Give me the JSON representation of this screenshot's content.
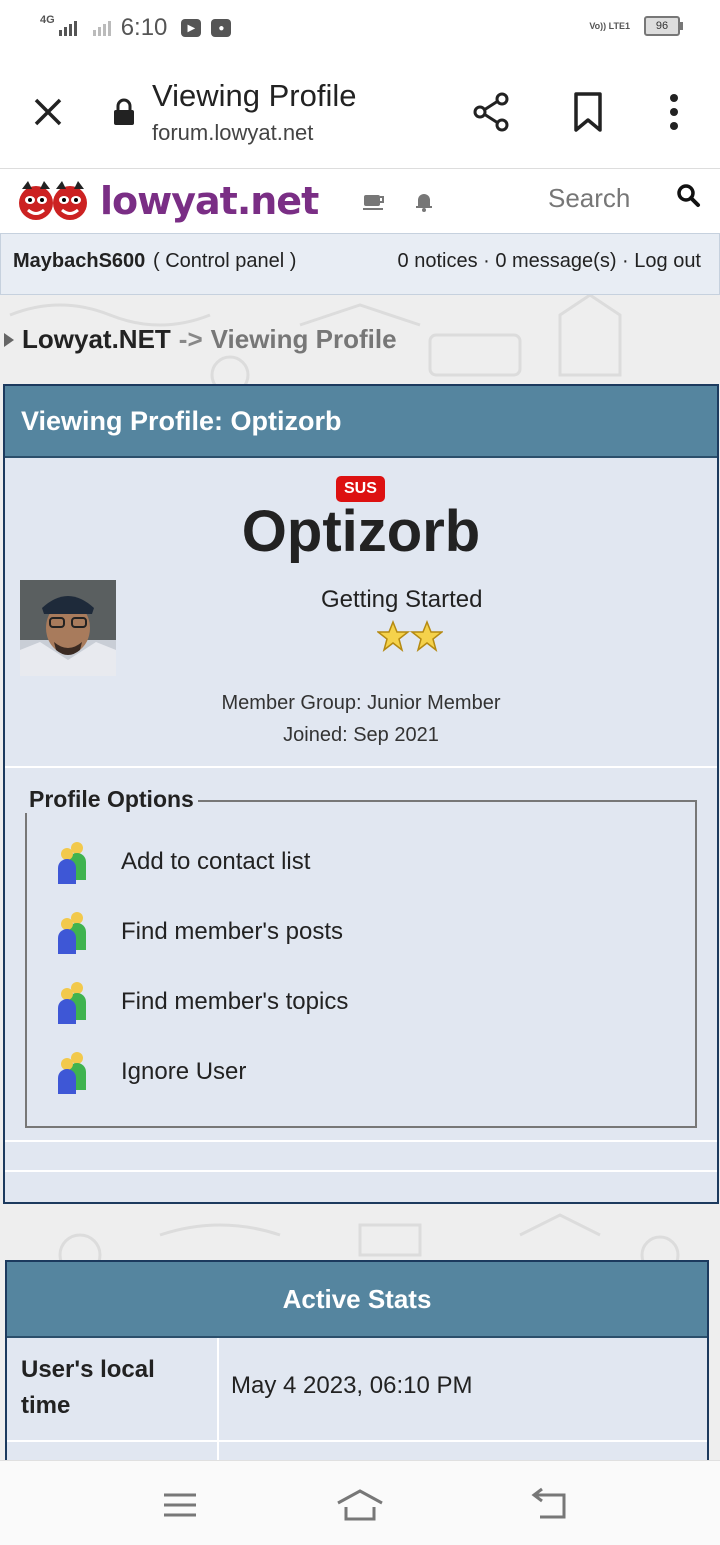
{
  "status_bar": {
    "network_left": "4G",
    "time": "6:10",
    "volte": "Vo)) LTE1",
    "battery": "96"
  },
  "browser": {
    "title": "Viewing Profile",
    "url": "forum.lowyat.net"
  },
  "site": {
    "logo_text": "lowyat.net",
    "search_label": "Search"
  },
  "userbar": {
    "username": "MaybachS600",
    "control_panel": "( Control panel )",
    "notices": "0 notices · 0 message(s) · Log out"
  },
  "breadcrumb": {
    "home": "Lowyat.NET",
    "sep": "->",
    "current": "Viewing Profile"
  },
  "profile": {
    "panel_title": "Viewing Profile: Optizorb",
    "badge": "SUS",
    "name": "Optizorb",
    "rank": "Getting Started",
    "group": "Member Group: Junior Member",
    "joined": "Joined: Sep 2021",
    "options_title": "Profile Options",
    "options": [
      {
        "label": "Add to contact list"
      },
      {
        "label": "Find member's posts"
      },
      {
        "label": "Find member's topics"
      },
      {
        "label": "Ignore User"
      }
    ]
  },
  "stats": {
    "title": "Active Stats",
    "rows": [
      {
        "key": "User's local time",
        "value": "May 4 2023, 06:10 PM"
      }
    ]
  },
  "colors": {
    "panel_header": "#55859f",
    "panel_body": "#e1e7f1",
    "logo": "#7a2e85",
    "badge": "#dd1111"
  }
}
